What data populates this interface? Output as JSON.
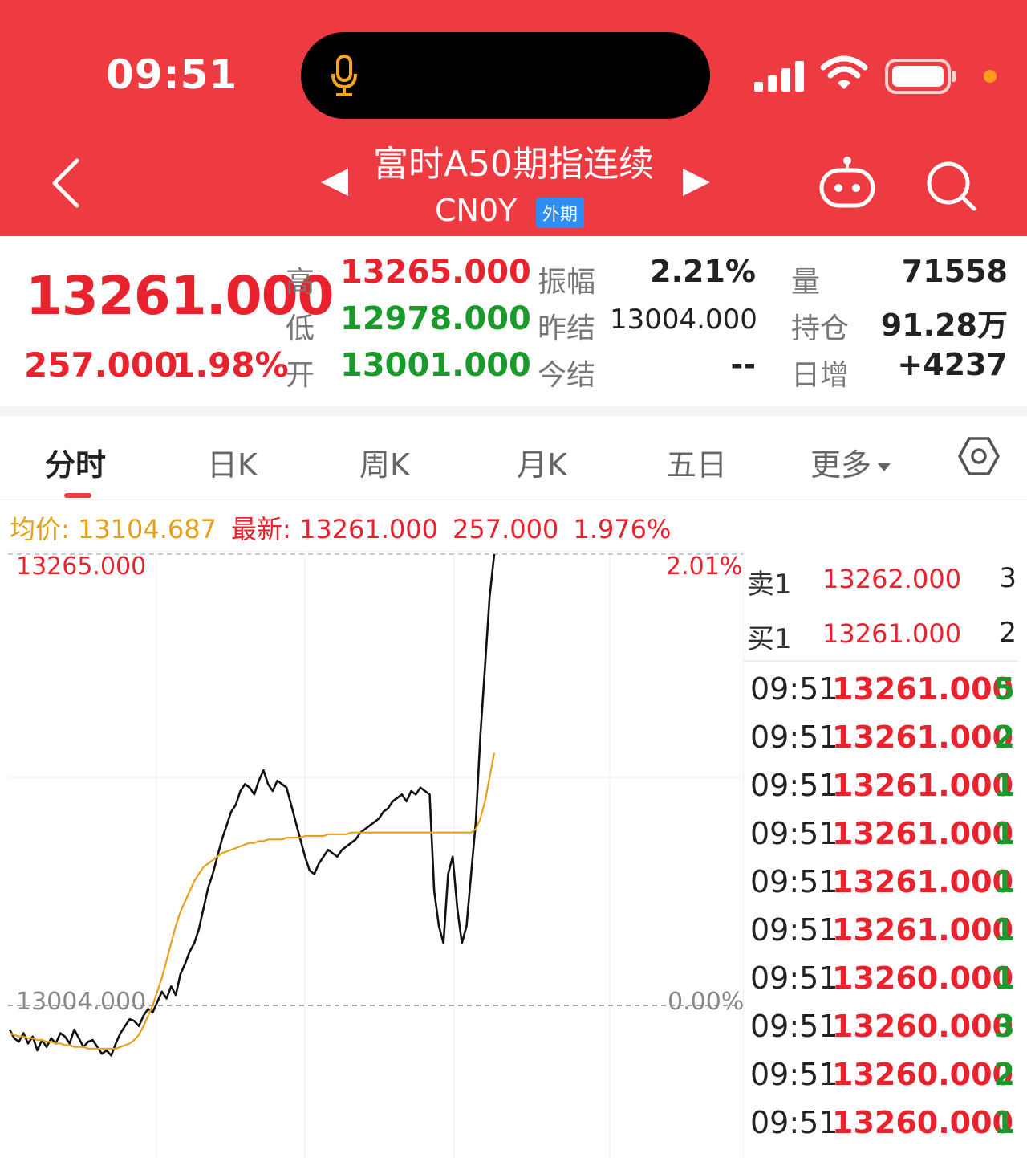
{
  "status_bar": {
    "time": "09:51"
  },
  "header": {
    "title": "富时A50期指连续",
    "code": "CN0Y",
    "tag": "外期"
  },
  "quote": {
    "price": "13261.000",
    "change": "257.000",
    "change_pct": "1.98%",
    "high_label": "高",
    "high": "13265.000",
    "low_label": "低",
    "low": "12978.000",
    "open_label": "开",
    "open": "13001.000",
    "amp_label": "振幅",
    "amp": "2.21%",
    "prev_settle_label": "昨结",
    "prev_settle": "13004.000",
    "settle_label": "今结",
    "settle": "--",
    "vol_label": "量",
    "vol": "71558",
    "oi_label": "持仓",
    "oi": "91.28万",
    "daily_inc_label": "日增",
    "daily_inc": "+4237"
  },
  "tabs": [
    "分时",
    "日K",
    "周K",
    "月K",
    "五日",
    "更多"
  ],
  "info_line": {
    "avg": "均价: 13104.687",
    "latest": "最新: 13261.000",
    "change": "257.000",
    "pct": "1.976%"
  },
  "colors": {
    "up": "#e8232d",
    "down": "#1a9a2a",
    "avg_line": "#e8a01b",
    "header": "#ee3a41"
  },
  "chart_data": {
    "type": "line",
    "y_top_label": "13265.000",
    "y_top_pct": "2.01%",
    "y_mid_label": "13004.000",
    "y_mid_pct": "0.00%",
    "ylim": [
      12978,
      13265
    ],
    "series": [
      {
        "values": [
          12990,
          12985,
          12983,
          12988,
          12982,
          12986,
          12978,
          12984,
          12980,
          12985,
          12982,
          12988,
          12986,
          12982,
          12990,
          12985,
          12980,
          12983,
          12984,
          12980,
          12976,
          12978,
          12975,
          12982,
          12988,
          12992,
          12996,
          12995,
          12992,
          12998,
          13002,
          13000,
          13006,
          13012,
          13008,
          13015,
          13010,
          13022,
          13028,
          13035,
          13040,
          13048,
          13060,
          13072,
          13080,
          13090,
          13100,
          13108,
          13116,
          13120,
          13128,
          13132,
          13130,
          13126,
          13134,
          13140,
          13132,
          13128,
          13134,
          13132,
          13130,
          13120,
          13110,
          13100,
          13090,
          13082,
          13080,
          13086,
          13090,
          13094,
          13092,
          13090,
          13094,
          13096,
          13098,
          13100,
          13104,
          13106,
          13108,
          13110,
          13112,
          13116,
          13118,
          13122,
          13124,
          13126,
          13122,
          13128,
          13126,
          13130,
          13128,
          13126,
          13070,
          13050,
          13040,
          13080,
          13090,
          13060,
          13040,
          13050,
          13080,
          13110,
          13160,
          13200,
          13240,
          13265
        ]
      },
      {
        "values": [
          12988,
          12987,
          12986,
          12986,
          12985,
          12985,
          12984,
          12984,
          12983,
          12983,
          12982,
          12982,
          12981,
          12981,
          12980,
          12980,
          12980,
          12979,
          12979,
          12979,
          12979,
          12979,
          12979,
          12979,
          12980,
          12981,
          12982,
          12984,
          12987,
          12992,
          12998,
          13004,
          13012,
          13020,
          13030,
          13040,
          13050,
          13058,
          13064,
          13070,
          13076,
          13080,
          13084,
          13086,
          13088,
          13090,
          13092,
          13093,
          13094,
          13095,
          13096,
          13097,
          13098,
          13098,
          13099,
          13099,
          13100,
          13100,
          13100,
          13100,
          13101,
          13101,
          13101,
          13101,
          13102,
          13102,
          13102,
          13102,
          13102,
          13103,
          13103,
          13103,
          13103,
          13103,
          13104,
          13104,
          13104,
          13104,
          13104,
          13104,
          13104,
          13104,
          13104,
          13104,
          13104,
          13104,
          13104,
          13104,
          13104,
          13104,
          13104,
          13104,
          13104,
          13104,
          13104,
          13104,
          13104,
          13104,
          13104,
          13104,
          13104,
          13106,
          13112,
          13122,
          13136,
          13150
        ]
      }
    ]
  },
  "orderbook": [
    {
      "side": "卖1",
      "price": "13262.000",
      "qty": "3"
    },
    {
      "side": "买1",
      "price": "13261.000",
      "qty": "2"
    }
  ],
  "trades": [
    {
      "time": "09:51",
      "price": "13261.000",
      "qty": "5"
    },
    {
      "time": "09:51",
      "price": "13261.000",
      "qty": "2"
    },
    {
      "time": "09:51",
      "price": "13261.000",
      "qty": "1"
    },
    {
      "time": "09:51",
      "price": "13261.000",
      "qty": "1"
    },
    {
      "time": "09:51",
      "price": "13261.000",
      "qty": "1"
    },
    {
      "time": "09:51",
      "price": "13261.000",
      "qty": "1"
    },
    {
      "time": "09:51",
      "price": "13260.000",
      "qty": "1"
    },
    {
      "time": "09:51",
      "price": "13260.000",
      "qty": "3"
    },
    {
      "time": "09:51",
      "price": "13260.000",
      "qty": "2"
    },
    {
      "time": "09:51",
      "price": "13260.000",
      "qty": "1"
    }
  ]
}
